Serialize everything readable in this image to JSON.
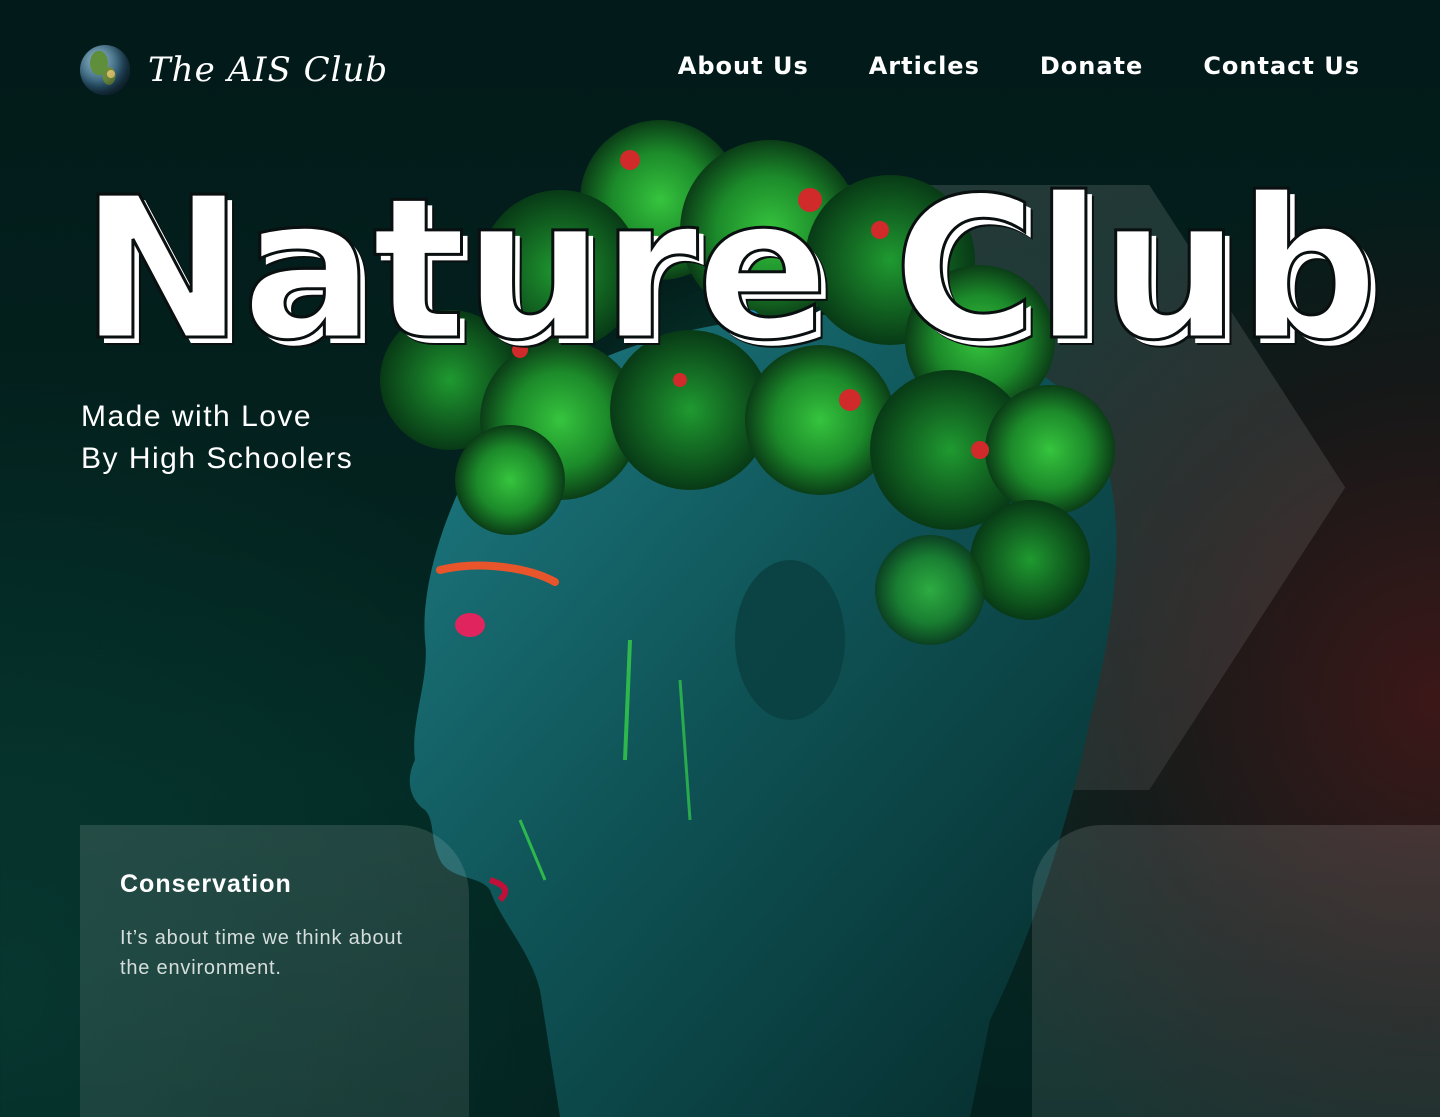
{
  "header": {
    "brand_name": "The AIS Club",
    "logo_icon": "globe-icon",
    "nav": [
      {
        "label": "About Us"
      },
      {
        "label": "Articles"
      },
      {
        "label": "Donate"
      },
      {
        "label": "Contact Us"
      }
    ]
  },
  "hero": {
    "title": "Nature Club",
    "tagline_line1": "Made with Love",
    "tagline_line2": "By High Schoolers",
    "illustration": "moss-covered-head-sculpture"
  },
  "cards": [
    {
      "title": "Conservation",
      "text": "It’s about time we think about the environment."
    },
    {
      "title": "",
      "text": ""
    }
  ],
  "colors": {
    "background": "#03201d",
    "accent_green": "#2ecc40",
    "accent_teal": "#1fa3a0",
    "text": "#ffffff"
  }
}
